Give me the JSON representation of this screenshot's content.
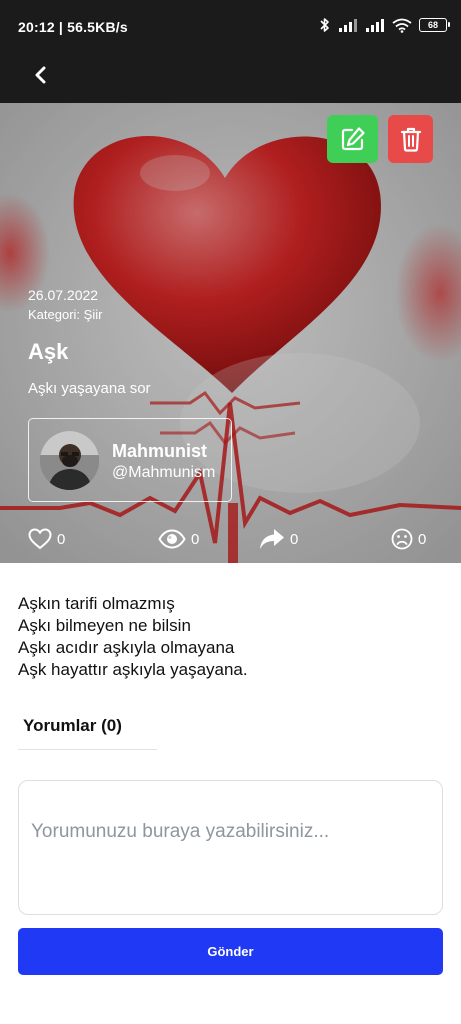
{
  "status_bar": {
    "time_speed": "20:12 | 56.5KB/s",
    "battery": "68"
  },
  "app_bar": {
    "back_icon": "chevron-left-icon"
  },
  "post": {
    "date": "26.07.2022",
    "category": "Kategori: Şiir",
    "title": "Aşk",
    "subtitle": "Aşkı yaşayana sor",
    "author": {
      "name": "Mahmunist",
      "handle": "@Mahmunism"
    },
    "stats": {
      "likes": "0",
      "views": "0",
      "shares": "0",
      "sad": "0"
    },
    "body_lines": [
      "Aşkın tarifi olmazmış",
      "Aşkı bilmeyen ne bilsin",
      "Aşkı acıdır aşkıyla olmayana",
      "Aşk hayattır aşkıyla yaşayana."
    ]
  },
  "actions": {
    "edit_icon": "edit-icon",
    "delete_icon": "trash-icon",
    "edit_color": "#3fcf56",
    "delete_color": "#e84a4a"
  },
  "comments": {
    "tab_label": "Yorumlar (0)",
    "placeholder": "Yorumunuzu buraya yazabilirsiniz...",
    "submit_label": "Gönder",
    "submit_color": "#1f39f5"
  }
}
